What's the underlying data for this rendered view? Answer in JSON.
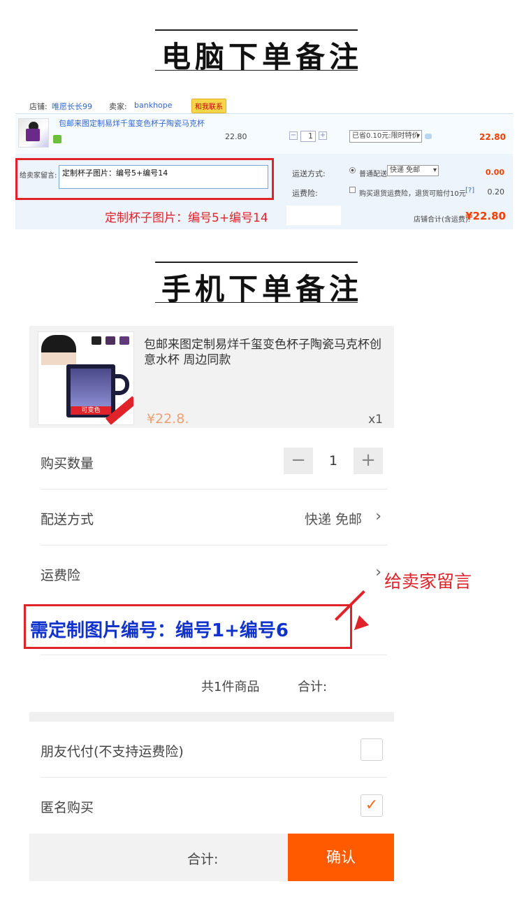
{
  "sections": {
    "pc_title": "电脑下单备注",
    "mobile_title": "手机下单备注"
  },
  "pc": {
    "shop_label": "店铺:",
    "shop_name": "唯愿长长99",
    "seller_label": "卖家:",
    "seller_name": "bankhope",
    "contact": "和我联系",
    "item_name": "包邮来图定制易烊千玺变色杯子陶瓷马克杯",
    "unit_price": "22.80",
    "quantity": "1",
    "promo": "已省0.10元:限时特价",
    "item_total": "22.80",
    "message_label": "给卖家留言:",
    "message_value": "定制杯子图片：编号5+编号14",
    "shipping_label": "运送方式:",
    "shipping_option": "普通配送",
    "shipping_select": "快递 免邮",
    "shipping_fee": "0.00",
    "insurance_label": "运费险:",
    "insurance_text": "购买退货运费险，退货可赔付10元",
    "insurance_help": "[?]",
    "insurance_fee": "0.20",
    "sum_label": "店铺合计(含运费):",
    "sum_value": "¥22.80",
    "caption": "定制杯子图片：编号5+编号14"
  },
  "mobile": {
    "product_title": "包邮来图定制易烊千玺变色杯子陶瓷马克杯创意水杯 周边同款",
    "product_price": "¥22.8.",
    "product_qty": "x1",
    "img_tag": "可变色",
    "rows": {
      "buy_qty_label": "购买数量",
      "buy_qty_value": "1",
      "shipping_label": "配送方式",
      "shipping_value": "快递 免邮",
      "insurance_label": "运费险",
      "friend_pay_label": "朋友代付(不支持运费险)",
      "anonymous_label": "匿名购买"
    },
    "note_text": "需定制图片编号：编号1+编号6",
    "tip_text": "给卖家留言",
    "count_text": "共1件商品",
    "subtotal_label": "合计:",
    "bottom_total_label": "合计:",
    "confirm_label": "确认"
  },
  "colors": {
    "accent_red": "#e0222a",
    "confirm_orange": "#ff5a00",
    "note_blue": "#1133cc",
    "price_orange": "#f04000"
  },
  "icons": {
    "chevron": "chevron-right-icon",
    "check": "checkmark-icon"
  }
}
